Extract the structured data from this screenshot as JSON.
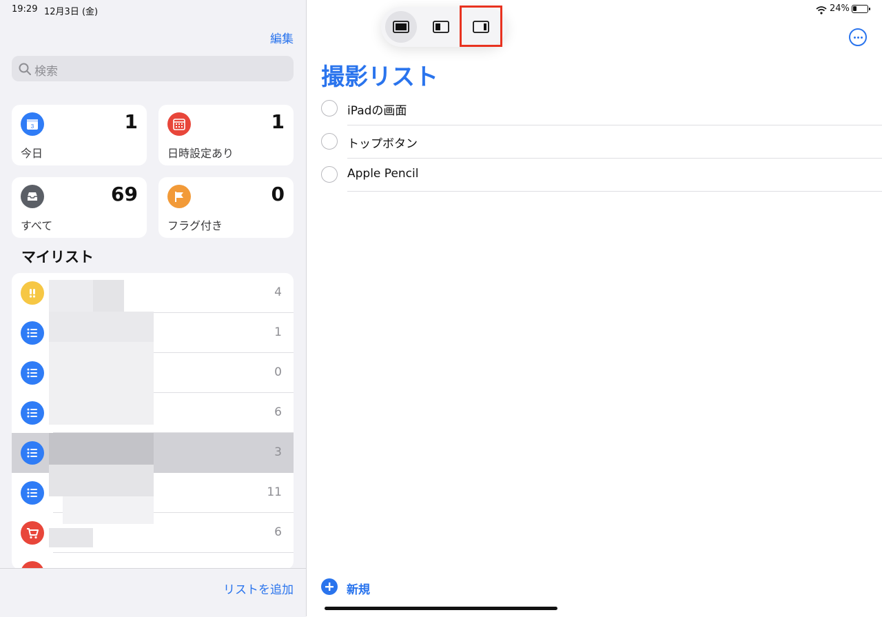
{
  "status": {
    "time": "19:29",
    "date": "12月3日 (金)",
    "battery": "24%"
  },
  "sidebar": {
    "edit_label": "編集",
    "search_placeholder": "検索",
    "smart_lists": [
      {
        "label": "今日",
        "count": "1",
        "icon": "calendar-today-icon",
        "color": "#2f7cf6"
      },
      {
        "label": "日時設定あり",
        "count": "1",
        "icon": "calendar-icon",
        "color": "#e8463a"
      },
      {
        "label": "すべて",
        "count": "69",
        "icon": "tray-icon",
        "color": "#5b5f66"
      },
      {
        "label": "フラグ付き",
        "count": "0",
        "icon": "flag-icon",
        "color": "#f29a38"
      }
    ],
    "my_lists_title": "マイリスト",
    "lists": [
      {
        "count": "4",
        "icon": "exclamation-icon",
        "color": "#f6c744"
      },
      {
        "count": "1",
        "icon": "list-bullet-icon",
        "color": "#2f7cf6"
      },
      {
        "count": "0",
        "icon": "list-bullet-icon",
        "color": "#2f7cf6"
      },
      {
        "count": "6",
        "icon": "list-bullet-icon",
        "color": "#2f7cf6"
      },
      {
        "count": "3",
        "icon": "list-bullet-icon",
        "color": "#2f7cf6",
        "selected": true
      },
      {
        "count": "11",
        "icon": "list-bullet-icon",
        "color": "#2f7cf6"
      },
      {
        "count": "6",
        "icon": "cart-icon",
        "color": "#e8463a"
      }
    ],
    "add_list_label": "リストを追加"
  },
  "main": {
    "title": "撮影リスト",
    "tasks": [
      "iPadの画面",
      "トップボタン",
      "Apple Pencil"
    ],
    "new_label": "新規"
  }
}
